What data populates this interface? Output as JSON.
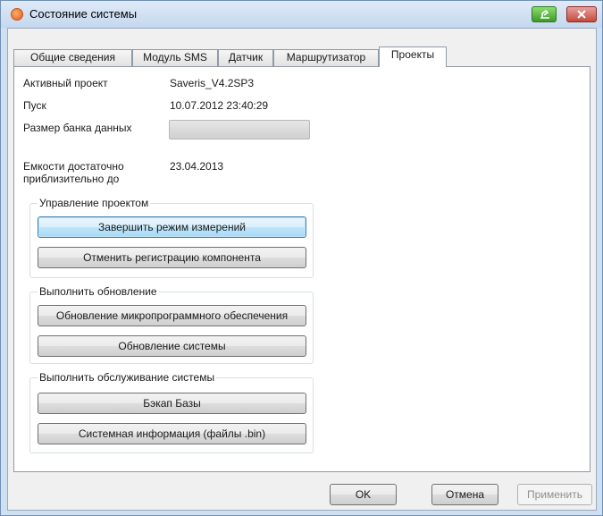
{
  "window": {
    "title": "Состояние системы",
    "icons": {
      "app": "testo-app-icon",
      "help": "help-icon",
      "close": "close-icon"
    }
  },
  "tabs": [
    {
      "label": "Общие сведения",
      "active": false
    },
    {
      "label": "Модуль SMS",
      "active": false
    },
    {
      "label": "Датчик",
      "active": false
    },
    {
      "label": "Маршрутизатор",
      "active": false
    },
    {
      "label": "Проекты",
      "active": true
    }
  ],
  "info": {
    "active_project_label": "Активный проект",
    "active_project_value": "Saveris_V4.2SP3",
    "start_label": "Пуск",
    "start_value": "10.07.2012 23:40:29",
    "db_size_label": "Размер банка данных",
    "capacity_label_line1": "Емкости достаточно",
    "capacity_label_line2": "приблизительно до",
    "capacity_value": "23.04.2013"
  },
  "groups": {
    "project_control": {
      "title": "Управление проектом",
      "buttons": [
        "Завершить режим измерений",
        "Отменить регистрацию компонента"
      ]
    },
    "update": {
      "title": "Выполнить обновление",
      "buttons": [
        "Обновление микропрограммного обеспечения",
        "Обновление системы"
      ]
    },
    "maintenance": {
      "title": "Выполнить обслуживание системы",
      "buttons": [
        "Бэкап Базы",
        "Системная информация (файлы .bin)"
      ]
    }
  },
  "footer": {
    "ok": "OK",
    "cancel": "Отмена",
    "apply": "Применить",
    "apply_enabled": false
  },
  "colors": {
    "focus_border": "#3c7fb1",
    "title_bar": "#c4d8ee",
    "close_button": "#c44a3a",
    "help_button": "#3e9a2a"
  }
}
